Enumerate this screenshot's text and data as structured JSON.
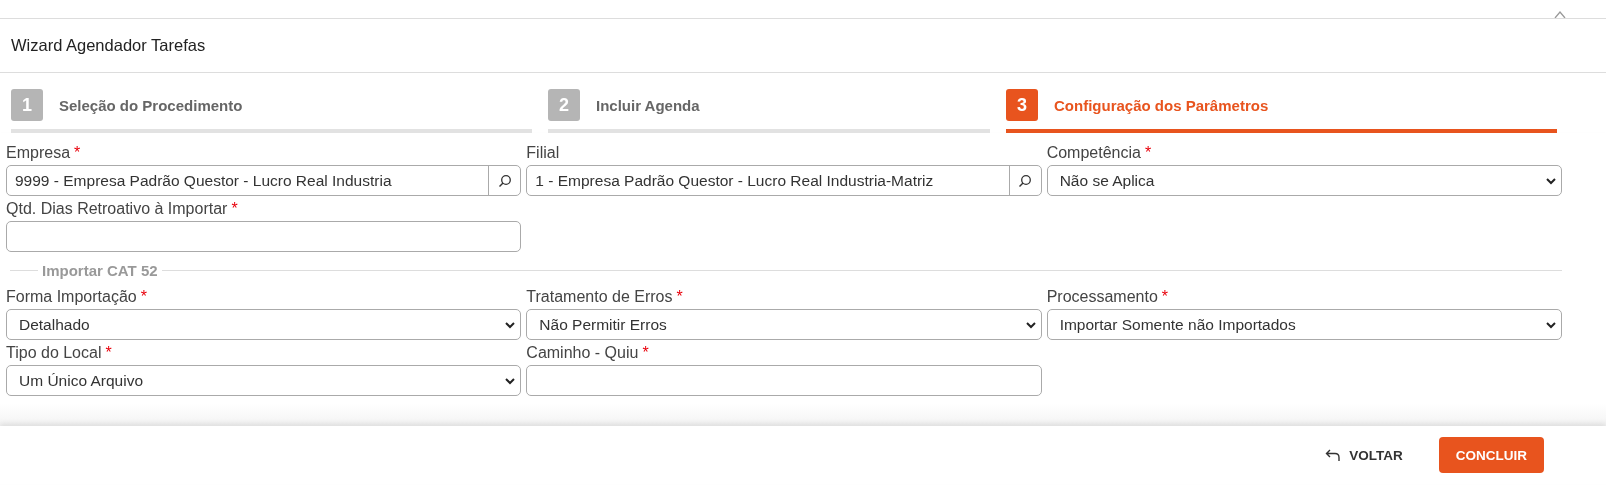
{
  "window": {
    "title": "Wizard Agendador Tarefas"
  },
  "steps": [
    {
      "number": "1",
      "label": "Seleção do Procedimento",
      "selected": false
    },
    {
      "number": "2",
      "label": "Incluir Agenda",
      "selected": false
    },
    {
      "number": "3",
      "label": "Configuração dos Parâmetros",
      "selected": true
    }
  ],
  "fields": [
    {
      "kind": "lookup",
      "label": "Empresa",
      "required_mark": "*",
      "value": "9999 - Empresa Padrão Questor - Lucro Real Industria"
    },
    {
      "kind": "lookup",
      "label": "Filial",
      "value": "1 - Empresa Padrão Questor - Lucro Real Industria-Matriz"
    },
    {
      "kind": "select",
      "label": "Competência",
      "required_mark": "*",
      "value": "Não se Aplica"
    },
    {
      "kind": "text",
      "label": "Qtd. Dias Retroativo à Importar",
      "required_mark": "*"
    }
  ],
  "section": {
    "title": "Importar CAT 52",
    "fields": [
      {
        "kind": "select",
        "label": "Forma Importação",
        "required_mark": "*",
        "value": "Detalhado"
      },
      {
        "kind": "select",
        "label": "Tratamento de Erros",
        "required_mark": "*",
        "value": "Não Permitir Erros"
      },
      {
        "kind": "select",
        "label": "Processamento",
        "required_mark": "*",
        "value": "Importar Somente não Importados"
      },
      {
        "kind": "select",
        "label": "Tipo do Local",
        "required_mark": "*",
        "value": "Um Único Arquivo"
      },
      {
        "kind": "text",
        "label": "Caminho - Quiu",
        "required_mark": "*"
      }
    ]
  },
  "footer": {
    "buttons": [
      {
        "kind": "back",
        "label": "VOLTAR"
      },
      {
        "kind": "primary",
        "label": "CONCLUIR"
      }
    ]
  }
}
